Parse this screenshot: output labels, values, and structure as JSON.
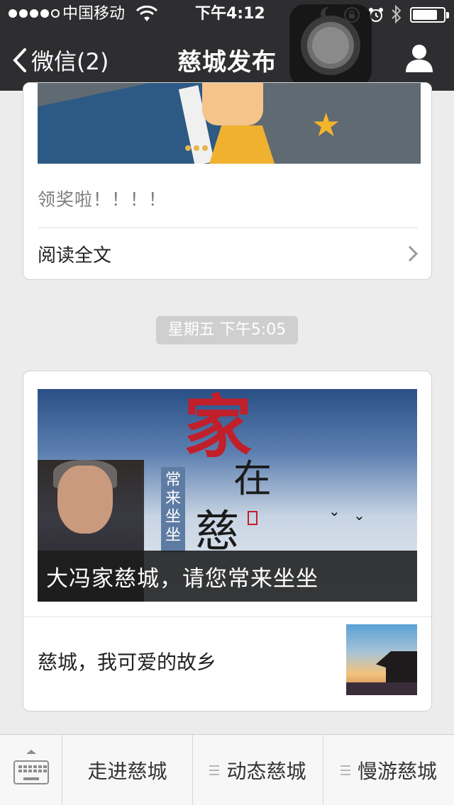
{
  "status_bar": {
    "carrier": "中国移动",
    "time": "下午4:12"
  },
  "nav": {
    "back_label": "微信(2)",
    "title": "慈城发布"
  },
  "message1": {
    "description": "领奖啦！！！！",
    "read_more_label": "阅读全文"
  },
  "timestamp": "星期五 下午5:05",
  "message2": {
    "cover_caption": "大冯家慈城，请您常来坐坐",
    "cover_art_text": {
      "char1": "家",
      "char2": "在",
      "char3": "慈",
      "vertical": "常来坐坐"
    },
    "sub_item_title": "慈城，我可爱的故乡"
  },
  "bottom_menu": {
    "items": [
      {
        "label": "走进慈城"
      },
      {
        "label": "动态慈城"
      },
      {
        "label": "慢游慈城"
      }
    ]
  },
  "colors": {
    "nav_bg": "#2e2d30",
    "page_bg": "#ececec",
    "timestamp_bg": "#cfcfcf"
  }
}
